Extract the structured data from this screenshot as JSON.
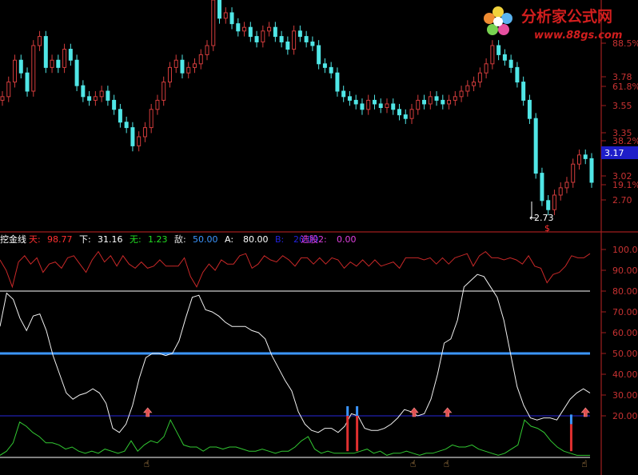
{
  "logo": {
    "title": "分析家公式网",
    "url": "www.88gs.com"
  },
  "price_panel": {
    "right_labels": [
      {
        "text": "88.5%",
        "color": "#c83232"
      },
      {
        "text": "3.78",
        "color": "#c83232"
      },
      {
        "text": "61.8%",
        "color": "#c83232"
      },
      {
        "text": "3.55",
        "color": "#c83232"
      },
      {
        "text": "3.35",
        "color": "#c83232"
      },
      {
        "text": "38.2%",
        "color": "#c83232"
      },
      {
        "text": "3.02",
        "color": "#c83232"
      },
      {
        "text": "19.1%",
        "color": "#c83232"
      },
      {
        "text": "2.70",
        "color": "#c83232"
      }
    ],
    "current_price": "3.17",
    "low_marker": "2.73",
    "dollar_marker": "$"
  },
  "indicator": {
    "name": "挖金线",
    "values": [
      {
        "label": "天:",
        "value": "98.77",
        "label_color": "#ff3030",
        "value_color": "#ff3030"
      },
      {
        "label": "下:",
        "value": "31.16",
        "label_color": "#ffffff",
        "value_color": "#ffffff"
      },
      {
        "label": "无:",
        "value": "1.23",
        "label_color": "#22dd22",
        "value_color": "#22dd22"
      },
      {
        "label": "敌:",
        "value": "50.00",
        "label_color": "#e0e0e0",
        "value_color": "#3c96ff"
      },
      {
        "label": "A:",
        "value": "80.00",
        "label_color": "#ffffff",
        "value_color": "#ffffff"
      },
      {
        "label": "B:",
        "value": "20.00",
        "label_color": "#2222dd",
        "value_color": "#2222dd"
      },
      {
        "label": "选股2:",
        "value": "0.00",
        "label_color": "#e040e0",
        "value_color": "#e040e0"
      }
    ],
    "right_labels": [
      "100.00",
      "90.00",
      "80.00",
      "70.00",
      "60.00",
      "50.00",
      "40.00",
      "30.00",
      "20.00"
    ]
  },
  "chart_data": [
    {
      "type": "candlestick",
      "y_range": [
        2.7,
        3.95
      ],
      "close": [
        3.42,
        3.5,
        3.62,
        3.55,
        3.45,
        3.7,
        3.75,
        3.58,
        3.62,
        3.58,
        3.68,
        3.62,
        3.48,
        3.42,
        3.4,
        3.42,
        3.45,
        3.4,
        3.35,
        3.28,
        3.25,
        3.15,
        3.2,
        3.25,
        3.35,
        3.4,
        3.5,
        3.58,
        3.62,
        3.55,
        3.58,
        3.6,
        3.65,
        3.7,
        3.95,
        3.85,
        3.88,
        3.82,
        3.78,
        3.8,
        3.75,
        3.72,
        3.78,
        3.8,
        3.75,
        3.72,
        3.68,
        3.78,
        3.75,
        3.72,
        3.7,
        3.6,
        3.58,
        3.55,
        3.45,
        3.42,
        3.4,
        3.38,
        3.35,
        3.4,
        3.38,
        3.36,
        3.38,
        3.35,
        3.32,
        3.3,
        3.35,
        3.4,
        3.38,
        3.42,
        3.4,
        3.38,
        3.4,
        3.42,
        3.45,
        3.48,
        3.5,
        3.55,
        3.6,
        3.7,
        3.65,
        3.62,
        3.58,
        3.5,
        3.4,
        3.3,
        3.0,
        2.85,
        2.8,
        2.88,
        2.92,
        2.95,
        3.05,
        3.1,
        3.08,
        2.95
      ],
      "colors": {
        "up": "#d23c3c",
        "down": "#50e6e6"
      },
      "right_axis_ticks": [
        "3.78",
        "3.55",
        "3.35",
        "3.02",
        "2.70"
      ],
      "fib_levels": [
        "88.5%",
        "61.8%",
        "38.2%",
        "19.1%"
      ],
      "current_price": 3.17,
      "low_point": 2.73
    },
    {
      "type": "line",
      "title": "挖金线",
      "y_range": [
        0,
        100
      ],
      "series": [
        {
          "name": "天",
          "color": "#c82828",
          "values": [
            95,
            90,
            82,
            94,
            97,
            93,
            96,
            89,
            93,
            94,
            91,
            96,
            97,
            93,
            89,
            95,
            99,
            94,
            97,
            92,
            97,
            93,
            91,
            94,
            91,
            92,
            95,
            92,
            92,
            92,
            96,
            87,
            82,
            89,
            93,
            90,
            95,
            93,
            93,
            97,
            98,
            91,
            93,
            97,
            95,
            94,
            97,
            95,
            92,
            96,
            96,
            93,
            96,
            93,
            96,
            95,
            91,
            94,
            92,
            95,
            92,
            95,
            92,
            93,
            94,
            91,
            96,
            96,
            96,
            95,
            96,
            93,
            96,
            93,
            96,
            97,
            98,
            92,
            97,
            99,
            96,
            96,
            95,
            96,
            95,
            93,
            97,
            92,
            91,
            84,
            88,
            89,
            92,
            97,
            96,
            96,
            98
          ]
        },
        {
          "name": "下",
          "color": "#f0f0f0",
          "values": [
            63,
            79,
            76,
            67,
            61,
            68,
            69,
            61,
            49,
            40,
            31,
            28,
            30,
            31,
            33,
            31,
            26,
            14,
            12,
            16,
            25,
            38,
            48,
            50,
            50,
            49,
            50,
            56,
            67,
            77,
            78,
            71,
            70,
            68,
            65,
            63,
            63,
            63,
            61,
            60,
            57,
            49,
            43,
            37,
            32,
            22,
            16,
            13,
            12,
            14,
            14,
            12,
            15,
            21,
            20,
            14,
            13,
            13,
            14,
            16,
            19,
            23,
            22,
            20,
            21,
            28,
            40,
            55,
            57,
            66,
            82,
            85,
            88,
            87,
            82,
            77,
            66,
            50,
            34,
            25,
            19,
            18,
            19,
            19,
            18,
            23,
            28,
            31,
            33,
            31
          ]
        },
        {
          "name": "无",
          "color": "#32c832",
          "values": [
            1,
            3,
            7,
            17,
            15,
            12,
            10,
            7,
            7,
            6,
            4,
            5,
            3,
            2,
            3,
            2,
            4,
            3,
            2,
            3,
            8,
            3,
            6,
            8,
            7,
            10,
            18,
            12,
            6,
            5,
            5,
            3,
            5,
            5,
            4,
            5,
            5,
            4,
            3,
            3,
            4,
            3,
            2,
            3,
            3,
            5,
            8,
            10,
            4,
            2,
            3,
            2,
            2,
            2,
            2,
            3,
            4,
            2,
            3,
            1,
            2,
            2,
            3,
            2,
            1,
            2,
            2,
            3,
            4,
            6,
            5,
            5,
            6,
            4,
            3,
            2,
            1,
            2,
            4,
            6,
            18,
            15,
            14,
            12,
            8,
            5,
            3,
            2,
            1,
            1,
            1
          ]
        },
        {
          "name": "敌",
          "color": "#3c96ff",
          "values": [
            50
          ]
        },
        {
          "name": "A",
          "color": "#ffffff",
          "values": [
            80
          ]
        },
        {
          "name": "B",
          "color": "#2828dc",
          "values": [
            20
          ]
        }
      ],
      "signals": [
        {
          "type": "up-arrow",
          "index": 26,
          "color": "#e05050"
        },
        {
          "type": "up-arrow",
          "index": 82,
          "color": "#e05050"
        },
        {
          "type": "up-arrow",
          "index": 89,
          "color": "#e05050"
        },
        {
          "type": "up-arrow",
          "index": 118,
          "color": "#e05050"
        },
        {
          "type": "bar",
          "index": 68,
          "from": 20,
          "to": 3,
          "color": "#e03030"
        },
        {
          "type": "bar",
          "index": 70,
          "from": 20,
          "to": 3,
          "color": "#e03030"
        },
        {
          "type": "bar",
          "index": 115,
          "from": 16,
          "to": 3,
          "color": "#e03030"
        }
      ]
    }
  ]
}
